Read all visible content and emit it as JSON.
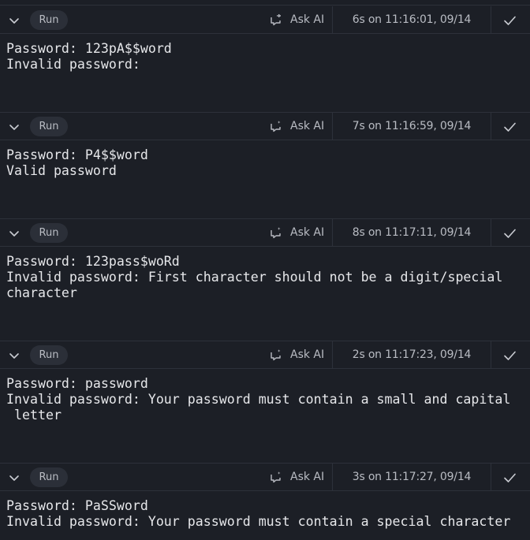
{
  "cells": [
    {
      "run_label": "Run",
      "ask_ai_label": "Ask AI",
      "timing": "6s on 11:16:01, 09/14",
      "output_lines": [
        "Password: 123pA$$word",
        "Invalid password:"
      ]
    },
    {
      "run_label": "Run",
      "ask_ai_label": "Ask AI",
      "timing": "7s on 11:16:59, 09/14",
      "output_lines": [
        "Password: P4$$word",
        "Valid password"
      ]
    },
    {
      "run_label": "Run",
      "ask_ai_label": "Ask AI",
      "timing": "8s on 11:17:11, 09/14",
      "output_lines": [
        "Password: 123pass$woRd",
        "Invalid password: First character should not be a digit/special",
        "character"
      ]
    },
    {
      "run_label": "Run",
      "ask_ai_label": "Ask AI",
      "timing": "2s on 11:17:23, 09/14",
      "output_lines": [
        "Password: password",
        "Invalid password: Your password must contain a small and capital",
        " letter"
      ]
    },
    {
      "run_label": "Run",
      "ask_ai_label": "Ask AI",
      "timing": "3s on 11:17:27, 09/14",
      "output_lines": [
        "Password: PaSSword",
        "Invalid password: Your password must contain a special character"
      ]
    }
  ],
  "icons": {
    "collapse": "chevron-down-icon",
    "ask_ai": "ai-sparkle-icon",
    "done": "checkmark-icon"
  },
  "colors": {
    "background": "#1c1f26",
    "border": "#2d313a",
    "run_button_bg": "#2b2f38",
    "text": "#e6e7ea",
    "muted_text": "#b9bcc3"
  }
}
